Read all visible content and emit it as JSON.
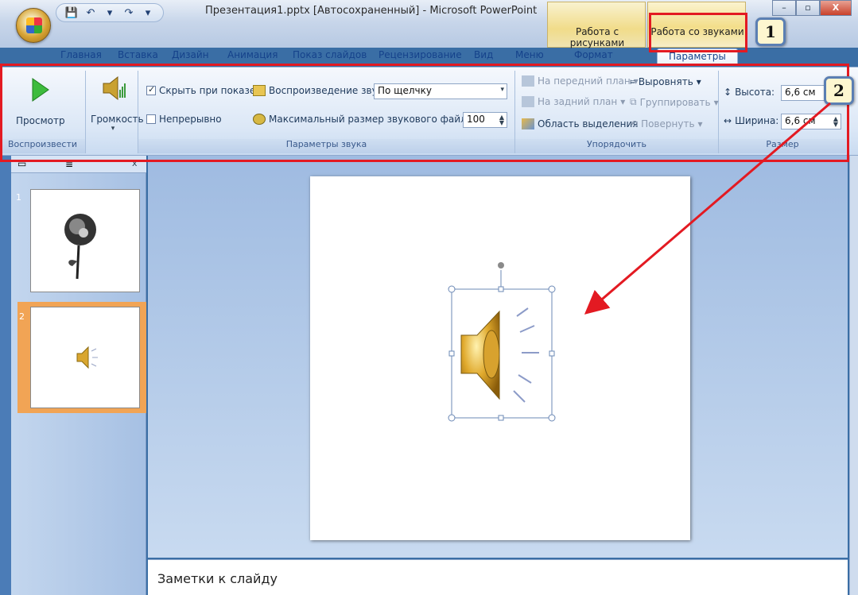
{
  "window": {
    "title": "Презентация1.pptx [Автосохраненный] - Microsoft PowerPoint",
    "context_tab_pictures": "Работа с рисунками",
    "context_tab_sounds": "Работа со звуками"
  },
  "tabs": [
    "Главная",
    "Вставка",
    "Дизайн",
    "Анимация",
    "Показ слайдов",
    "Рецензирование",
    "Вид",
    "Меню",
    "Формат",
    "Параметры"
  ],
  "ribbon": {
    "preview_label": "Просмотр",
    "volume_label": "Громкость",
    "group_play": "Воспроизвести",
    "hide_on_show": "Скрыть при показе",
    "loop": "Непрерывно",
    "play_sound_label": "Воспроизведение звука:",
    "play_sound_value": "По щелчку",
    "max_size_label": "Максимальный размер звукового файла (КБ):",
    "max_size_value": "100",
    "group_sound_options": "Параметры звука",
    "bring_front": "На передний план",
    "send_back": "На задний план",
    "selection_pane": "Область выделения",
    "align": "Выровнять",
    "group": "Группировать",
    "rotate": "Повернуть",
    "group_arrange": "Упорядочить",
    "height_label": "Высота:",
    "height_value": "6,6 см",
    "width_label": "Ширина:",
    "width_value": "6,6 см",
    "group_size": "Размер"
  },
  "slides": [
    {
      "number": "1"
    },
    {
      "number": "2"
    }
  ],
  "notes_placeholder": "Заметки к слайду",
  "callouts": [
    "1",
    "2"
  ],
  "colors": {
    "annotation_red": "#e31a22",
    "callout_border": "#5b7fb3"
  }
}
